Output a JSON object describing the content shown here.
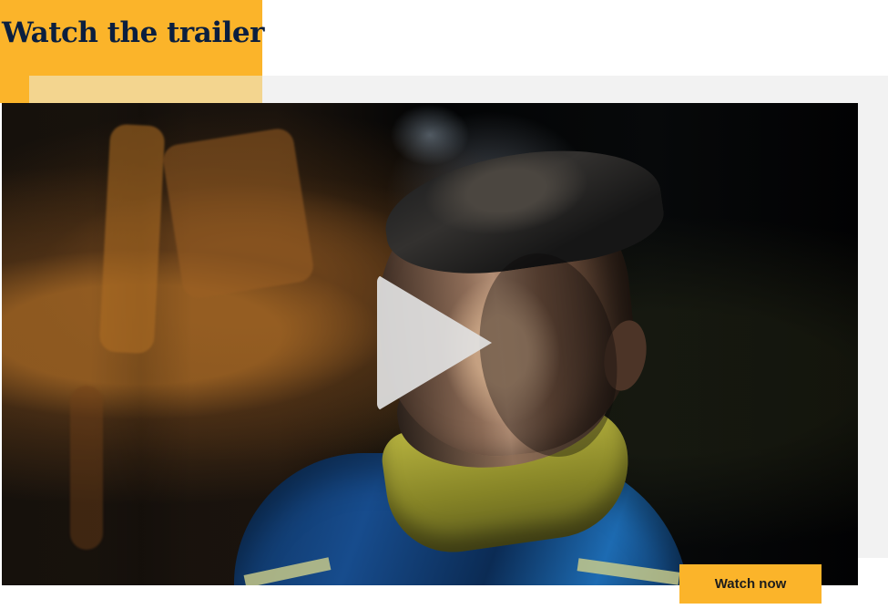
{
  "header": {
    "title": "Watch the trailer"
  },
  "video": {
    "play_icon": "play-icon"
  },
  "actions": {
    "watch_now_label": "Watch now"
  },
  "colors": {
    "accent_yellow": "#fbb42a",
    "pale_yellow": "#f3d58f",
    "panel_gray": "#f2f2f2",
    "title_navy": "#0b1f3f",
    "video_dark": "#050607",
    "play_white": "#e6e6e6"
  }
}
